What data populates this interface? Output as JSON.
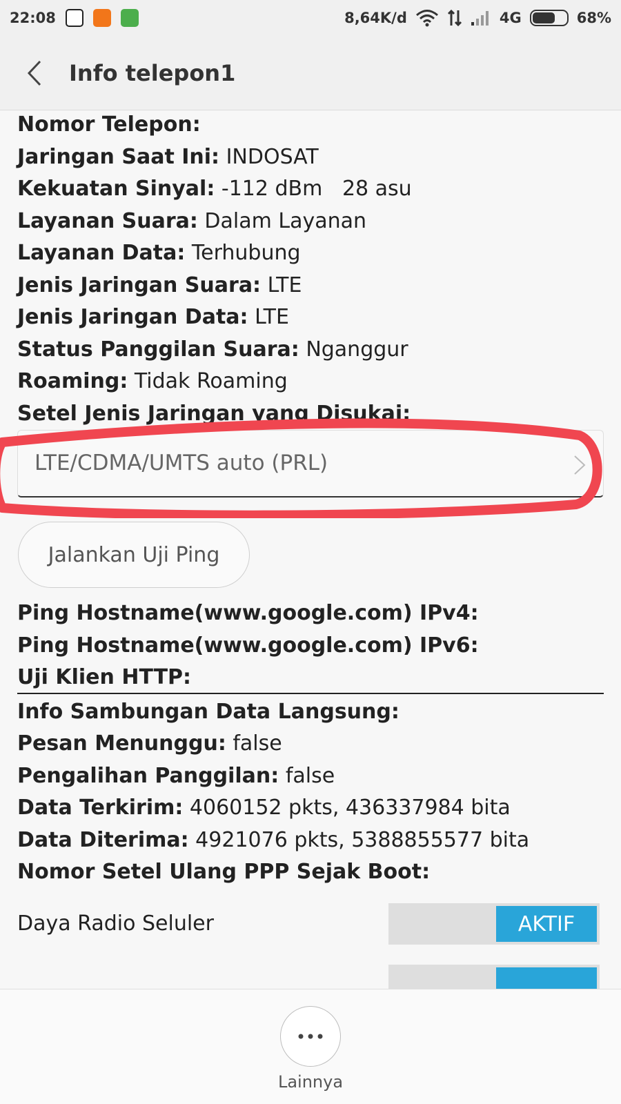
{
  "status": {
    "time": "22:08",
    "speed": "8,64K/d",
    "network": "4G",
    "battery": "68%",
    "battery_level": 0.68
  },
  "header": {
    "title": "Info telepon1"
  },
  "info": [
    {
      "label": "Nomor Telepon:",
      "value": ""
    },
    {
      "label": "Jaringan Saat Ini:",
      "value": " INDOSAT"
    },
    {
      "label": "Kekuatan Sinyal:",
      "value": " -112 dBm   28 asu"
    },
    {
      "label": "Layanan Suara:",
      "value": " Dalam Layanan"
    },
    {
      "label": "Layanan Data:",
      "value": " Terhubung"
    },
    {
      "label": "Jenis Jaringan Suara:",
      "value": " LTE"
    },
    {
      "label": "Jenis Jaringan Data:",
      "value": " LTE"
    },
    {
      "label": "Status Panggilan Suara:",
      "value": " Nganggur"
    },
    {
      "label": "Roaming:",
      "value": " Tidak Roaming"
    },
    {
      "label": "Setel Jenis Jaringan yang Disukai:",
      "value": ""
    }
  ],
  "preferred_network": "LTE/CDMA/UMTS auto (PRL)",
  "ping_button": "Jalankan Uji Ping",
  "ping": [
    {
      "label": "Ping Hostname(www.google.com) IPv4:",
      "value": ""
    },
    {
      "label": "Ping Hostname(www.google.com) IPv6:",
      "value": ""
    },
    {
      "label": "Uji Klien HTTP:",
      "value": ""
    }
  ],
  "data_info": [
    {
      "label": "Info Sambungan Data Langsung:",
      "value": ""
    },
    {
      "label": "Pesan Menunggu:",
      "value": " false"
    },
    {
      "label": "Pengalihan Panggilan:",
      "value": " false"
    },
    {
      "label": "Data Terkirim:",
      "value": " 4060152 pkts, 436337984 bita"
    },
    {
      "label": "Data Diterima:",
      "value": " 4921076 pkts, 5388855577 bita"
    },
    {
      "label": "Nomor Setel Ulang PPP Sejak Boot:",
      "value": ""
    }
  ],
  "radio": {
    "label": "Daya Radio Seluler",
    "state": "AKTIF"
  },
  "bottom": {
    "more_label": "Lainnya"
  },
  "colors": {
    "accent": "#29a5d9",
    "highlight": "#f04650"
  }
}
